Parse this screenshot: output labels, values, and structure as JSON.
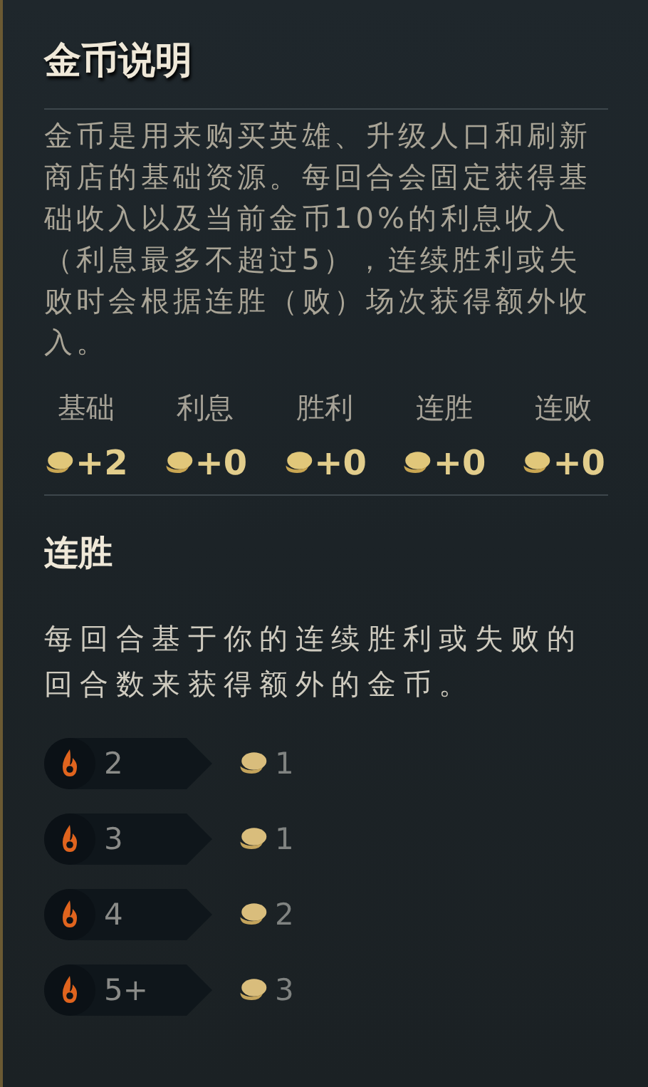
{
  "title": "金币说明",
  "description": "金币是用来购买英雄、升级人口和刷新商店的基础资源。每回合会固定获得基础收入以及当前金币10%的利息收入（利息最多不超过5），连续胜利或失败时会根据连胜（败）场次获得额外收入。",
  "income": [
    {
      "label": "基础",
      "value": "+2"
    },
    {
      "label": "利息",
      "value": "+0"
    },
    {
      "label": "胜利",
      "value": "+0"
    },
    {
      "label": "连胜",
      "value": "+0"
    },
    {
      "label": "连败",
      "value": "+0"
    }
  ],
  "streak_section": {
    "title": "连胜",
    "description": "每回合基于你的连续胜利或失败的回合数来获得额外的金币。",
    "rows": [
      {
        "streak": "2",
        "gold": "1"
      },
      {
        "streak": "3",
        "gold": "1"
      },
      {
        "streak": "4",
        "gold": "2"
      },
      {
        "streak": "5+",
        "gold": "3"
      }
    ]
  }
}
